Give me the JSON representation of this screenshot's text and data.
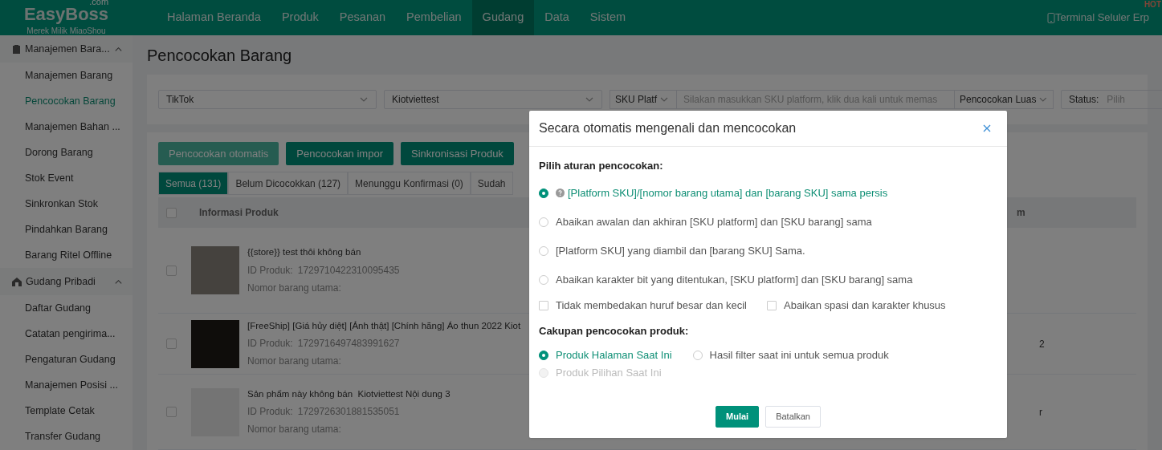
{
  "brand": {
    "name": "EasyBoss",
    "suffix": ".com",
    "tagline": "Merek Milik MiaoShou"
  },
  "nav": [
    {
      "label": "Halaman Beranda",
      "selected": false
    },
    {
      "label": "Produk",
      "selected": false
    },
    {
      "label": "Pesanan",
      "selected": false
    },
    {
      "label": "Pembelian",
      "selected": false
    },
    {
      "label": "Gudang",
      "selected": true
    },
    {
      "label": "Data",
      "selected": false
    },
    {
      "label": "Sistem",
      "selected": false
    }
  ],
  "header_right": {
    "label": "Terminal Seluler Erp",
    "badge": "HOT"
  },
  "sidebar": [
    {
      "label": "Manajemen Bara...",
      "expanded": true,
      "children": [
        {
          "label": "Manajemen Barang",
          "selected": false
        },
        {
          "label": "Pencocokan Barang",
          "selected": true
        },
        {
          "label": "Manajemen Bahan ...",
          "selected": false
        },
        {
          "label": "Dorong Barang",
          "selected": false
        },
        {
          "label": "Stok Event",
          "selected": false
        },
        {
          "label": "Sinkronkan Stok",
          "selected": false
        },
        {
          "label": "Pindahkan Barang",
          "selected": false
        },
        {
          "label": "Barang Ritel Offline",
          "selected": false
        }
      ]
    },
    {
      "label": "Gudang Pribadi",
      "expanded": true,
      "children": [
        {
          "label": "Daftar Gudang",
          "selected": false
        },
        {
          "label": "Catatan pengirima...",
          "selected": false
        },
        {
          "label": "Pengaturan Gudang",
          "selected": false
        },
        {
          "label": "Manajemen Posisi ...",
          "selected": false
        },
        {
          "label": "Template Cetak",
          "selected": false
        },
        {
          "label": "Transfer Gudang",
          "selected": false
        }
      ]
    }
  ],
  "page_title": "Pencocokan Barang",
  "filters": [
    {
      "kind": "select",
      "value": "TikTok"
    },
    {
      "kind": "select",
      "value": "Kiotviettest"
    },
    {
      "kind": "search",
      "mode": "SKU Platf",
      "placeholder": "Silakan masukkan SKU platform, klik dua kali untuk memas",
      "match": "Pencocokan Luas"
    },
    {
      "kind": "status",
      "label": "Status:",
      "placeholder": "Pilih"
    }
  ],
  "actions": [
    {
      "label": "Pencocokan otomatis",
      "disabled": true
    },
    {
      "label": "Pencocokan impor",
      "disabled": false
    },
    {
      "label": "Sinkronisasi Produk",
      "disabled": false
    }
  ],
  "tabs": [
    {
      "label": "Semua (131)",
      "selected": true
    },
    {
      "label": "Belum Dicocokkan (127)",
      "selected": false
    },
    {
      "label": "Menunggu Konfirmasi (0)",
      "selected": false
    },
    {
      "label": "Sudah",
      "selected": false
    }
  ],
  "table": {
    "all_checked": false,
    "columns": [
      "Informasi Produk",
      "m"
    ],
    "rows": [
      {
        "checked": false,
        "title": "{{store}} test thôi không bán",
        "id_label": "ID Produk:",
        "id": "1729710422310095435",
        "main_label": "Nomor barang utama:"
      },
      {
        "checked": false,
        "title": "[FreeShip] [Giá hủy diệt] [Ảnh thật] [Chính hãng] Áo thun 2022 Kiot",
        "id_label": "ID Produk:",
        "id": "1729716497483991627",
        "main_label": "Nomor barang utama:",
        "column_2": "2"
      },
      {
        "checked": false,
        "title": "Sản phẩm này không bán  Kiotviettest Nội dung 3",
        "id_label": "ID Produk:",
        "id": "1729726301881535051",
        "main_label": "Nomor barang utama:",
        "column_2": "r"
      }
    ]
  },
  "dialog": {
    "title": "Secara otomatis mengenali dan mencocokan",
    "rules_heading": "Pilih aturan pencocokan:",
    "rules": [
      {
        "label": "[Platform SKU]/[nomor barang utama] dan [barang SKU] sama persis",
        "selected": true,
        "help": true
      },
      {
        "label": "Abaikan awalan dan akhiran [SKU platform] dan [SKU barang] sama",
        "selected": false,
        "help": false
      },
      {
        "label": "[Platform SKU] yang diambil dan [barang SKU] Sama.",
        "selected": false,
        "help": false
      },
      {
        "label": "Abaikan karakter bit yang ditentukan, [SKU platform] dan [SKU barang] sama",
        "selected": false,
        "help": false
      }
    ],
    "flags": [
      {
        "label": "Tidak membedakan huruf besar dan kecil",
        "checked": false
      },
      {
        "label": "Abaikan spasi dan karakter khusus",
        "checked": false
      }
    ],
    "scope_heading": "Cakupan pencocokan produk:",
    "scope": [
      {
        "label": "Produk Halaman Saat Ini",
        "selected": true,
        "disabled": false
      },
      {
        "label": "Hasil filter saat ini untuk semua produk",
        "selected": false,
        "disabled": false
      },
      {
        "label": "Produk Pilihan Saat Ini",
        "selected": false,
        "disabled": true
      }
    ],
    "buttons": [
      {
        "label": "Mulai",
        "kind": "primary"
      },
      {
        "label": "Batalkan",
        "kind": "default"
      }
    ]
  }
}
